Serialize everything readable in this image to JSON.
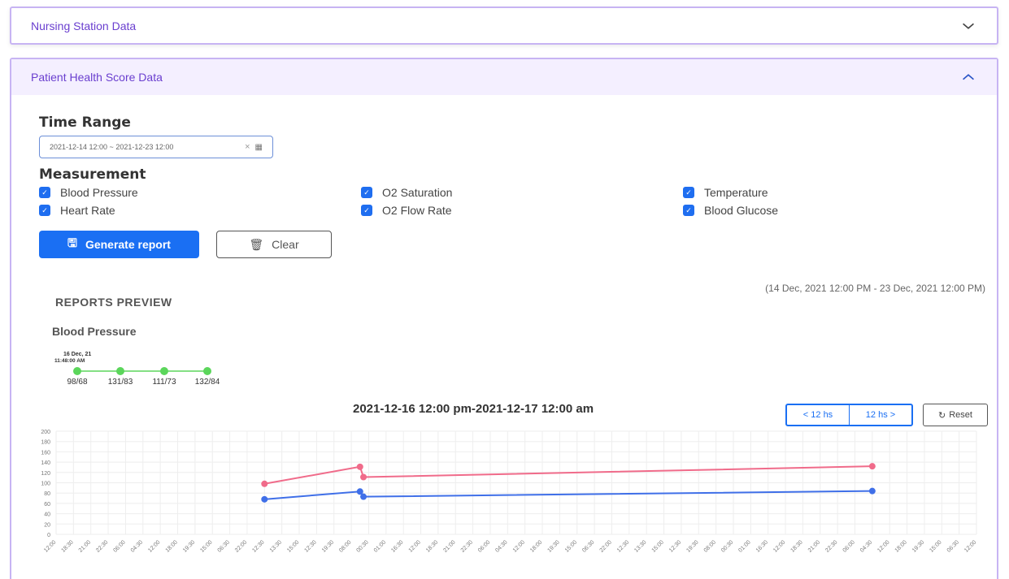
{
  "panels": {
    "nursing": {
      "title": "Nursing Station Data"
    },
    "health": {
      "title": "Patient Health Score Data"
    }
  },
  "time_range": {
    "label": "Time Range",
    "value": "2021-12-14 12:00 ~ 2021-12-23 12:00"
  },
  "measurement": {
    "label": "Measurement",
    "options": [
      {
        "label": "Blood Pressure",
        "checked": true
      },
      {
        "label": "O2 Saturation",
        "checked": true
      },
      {
        "label": "Temperature",
        "checked": true
      },
      {
        "label": "Heart Rate",
        "checked": true
      },
      {
        "label": "O2 Flow Rate",
        "checked": true
      },
      {
        "label": "Blood Glucose",
        "checked": true
      }
    ]
  },
  "buttons": {
    "generate": "Generate report",
    "clear": "Clear",
    "prev": "< 12 hs",
    "next": "12 hs >",
    "reset": "Reset"
  },
  "preview": {
    "title": "REPORTS PREVIEW",
    "range": "(14 Dec, 2021 12:00 PM - 23 Dec, 2021 12:00 PM)",
    "bp_title": "Blood Pressure",
    "mini": {
      "tooltip_line1": "16 Dec, 21",
      "tooltip_line2": "11:48:00 AM",
      "readings": [
        "98/68",
        "131/83",
        "111/73",
        "132/84"
      ]
    }
  },
  "colors": {
    "accent": "#1a6ff3",
    "panel_border": "#c7b4f3",
    "systolic": "#f06b8a",
    "diastolic": "#3f6fe8",
    "mini_line": "#5bd65b"
  },
  "chart_data": {
    "type": "line",
    "title": "2021-12-16 12:00 pm-2021-12-17 12:00 am",
    "ylim": [
      0,
      200
    ],
    "y_ticks": [
      0,
      20,
      40,
      60,
      80,
      100,
      120,
      140,
      160,
      180,
      200
    ],
    "x_tick_labels": [
      "12:00",
      "18:30",
      "21:00",
      "22:30",
      "06:00",
      "04:30",
      "12:00",
      "18:00",
      "19:30",
      "15:00",
      "06:30",
      "22:00",
      "12:30",
      "13:30",
      "15:00",
      "12:30",
      "19:30",
      "08:00",
      "00:30",
      "01:00",
      "16:30",
      "12:00",
      "18:30",
      "21:00",
      "22:30",
      "06:00",
      "04:30",
      "12:00",
      "18:00",
      "19:30",
      "15:00",
      "06:30",
      "22:00",
      "12:30",
      "13:30",
      "15:00",
      "12:30",
      "19:30",
      "08:00",
      "00:30",
      "01:00",
      "16:30",
      "12:00",
      "18:30",
      "21:00",
      "22:30",
      "06:00",
      "04:30",
      "12:00",
      "18:00",
      "19:30",
      "15:00",
      "06:30",
      "12:00"
    ],
    "grid": true,
    "series": [
      {
        "points": [
          [
            12,
            98
          ],
          [
            17.5,
            131
          ],
          [
            17.7,
            111
          ],
          [
            47,
            132
          ]
        ]
      },
      {
        "points": [
          [
            12,
            68
          ],
          [
            17.5,
            83
          ],
          [
            17.7,
            73
          ],
          [
            47,
            84
          ]
        ]
      }
    ]
  }
}
